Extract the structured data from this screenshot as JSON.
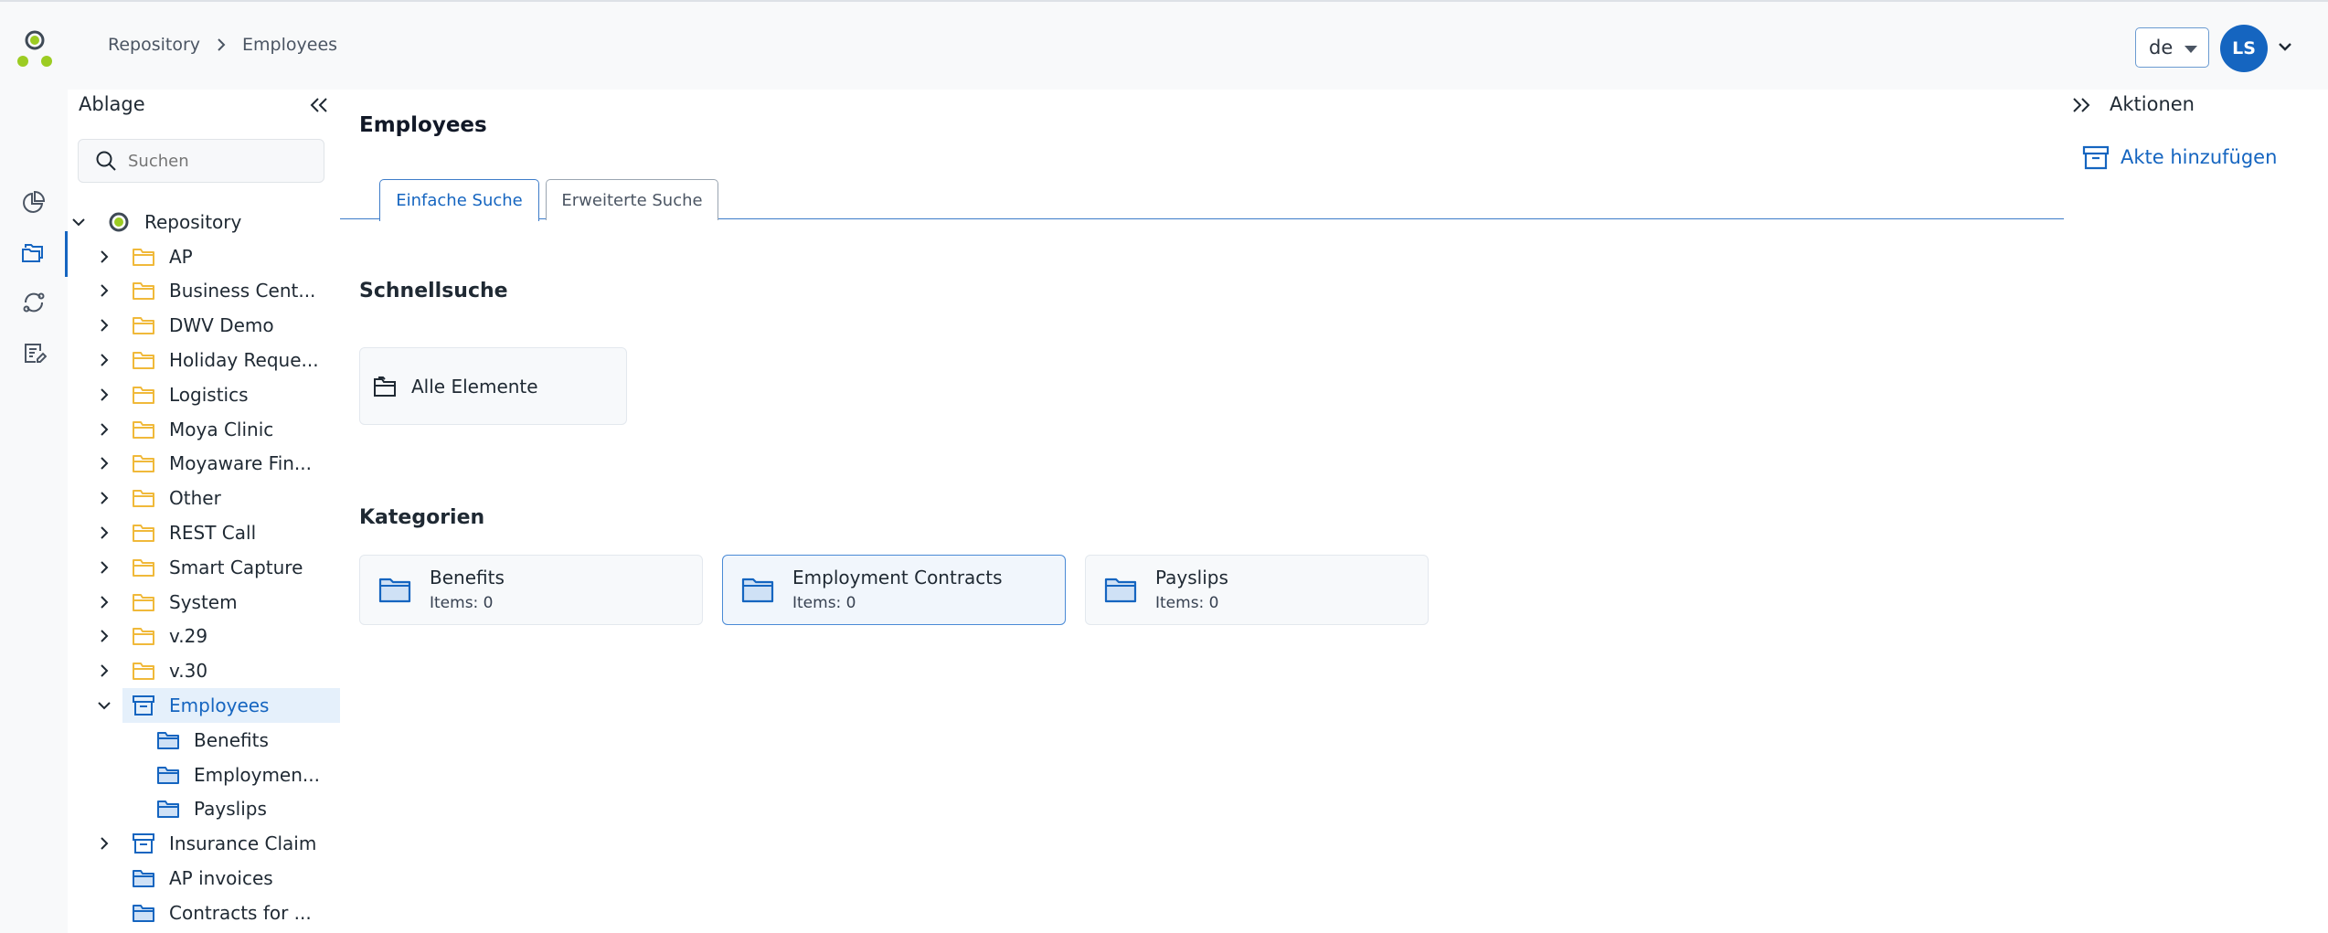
{
  "header": {
    "breadcrumb": [
      "Repository",
      "Employees"
    ],
    "language": "de",
    "user_initials": "LS"
  },
  "tree_panel": {
    "title": "Ablage",
    "search_placeholder": "Suchen",
    "items": [
      {
        "label": "Repository",
        "level": 0,
        "expanded": true,
        "icon": "repository-icon"
      },
      {
        "label": "AP",
        "level": 1,
        "icon": "folder-icon"
      },
      {
        "label": "Business Cent...",
        "level": 1,
        "icon": "folder-icon"
      },
      {
        "label": "DWV Demo",
        "level": 1,
        "icon": "folder-icon"
      },
      {
        "label": "Holiday Reque...",
        "level": 1,
        "icon": "folder-icon"
      },
      {
        "label": "Logistics",
        "level": 1,
        "icon": "folder-icon"
      },
      {
        "label": "Moya Clinic",
        "level": 1,
        "icon": "folder-icon"
      },
      {
        "label": "Moyaware Fin...",
        "level": 1,
        "icon": "folder-icon"
      },
      {
        "label": "Other",
        "level": 1,
        "icon": "folder-icon"
      },
      {
        "label": "REST Call",
        "level": 1,
        "icon": "folder-icon"
      },
      {
        "label": "Smart Capture",
        "level": 1,
        "icon": "folder-icon"
      },
      {
        "label": "System",
        "level": 1,
        "icon": "folder-icon"
      },
      {
        "label": "v.29",
        "level": 1,
        "icon": "folder-icon"
      },
      {
        "label": "v.30",
        "level": 1,
        "icon": "folder-icon"
      },
      {
        "label": "Employees",
        "level": 1,
        "expanded": true,
        "selected": true,
        "icon": "archive-icon"
      },
      {
        "label": "Benefits",
        "level": 2,
        "icon": "category-folder-icon"
      },
      {
        "label": "Employmen...",
        "level": 2,
        "icon": "category-folder-icon"
      },
      {
        "label": "Payslips",
        "level": 2,
        "icon": "category-folder-icon"
      },
      {
        "label": "Insurance Claim",
        "level": 1,
        "icon": "archive-icon"
      },
      {
        "label": "AP invoices",
        "level": 1,
        "nochevron": true,
        "icon": "category-folder-icon"
      },
      {
        "label": "Contracts for ...",
        "level": 1,
        "nochevron": true,
        "icon": "category-folder-icon"
      }
    ]
  },
  "main": {
    "title": "Employees",
    "tabs": [
      {
        "label": "Einfache Suche",
        "active": true
      },
      {
        "label": "Erweiterte Suche",
        "active": false
      }
    ],
    "quick_search": {
      "title": "Schnellsuche",
      "item_label": "Alle Elemente"
    },
    "categories": {
      "title": "Kategorien",
      "items": [
        {
          "name": "Benefits",
          "count": "Items: 0"
        },
        {
          "name": "Employment Contracts",
          "count": "Items: 0",
          "highlighted": true
        },
        {
          "name": "Payslips",
          "count": "Items: 0"
        }
      ]
    }
  },
  "actions_panel": {
    "title": "Aktionen",
    "add_file_label": "Akte hinzufügen"
  },
  "colors": {
    "accent": "#1565c0",
    "folder_yellow": "#f0b93a",
    "logo_green": "#9ccc22",
    "logo_dark": "#3f4a56"
  }
}
